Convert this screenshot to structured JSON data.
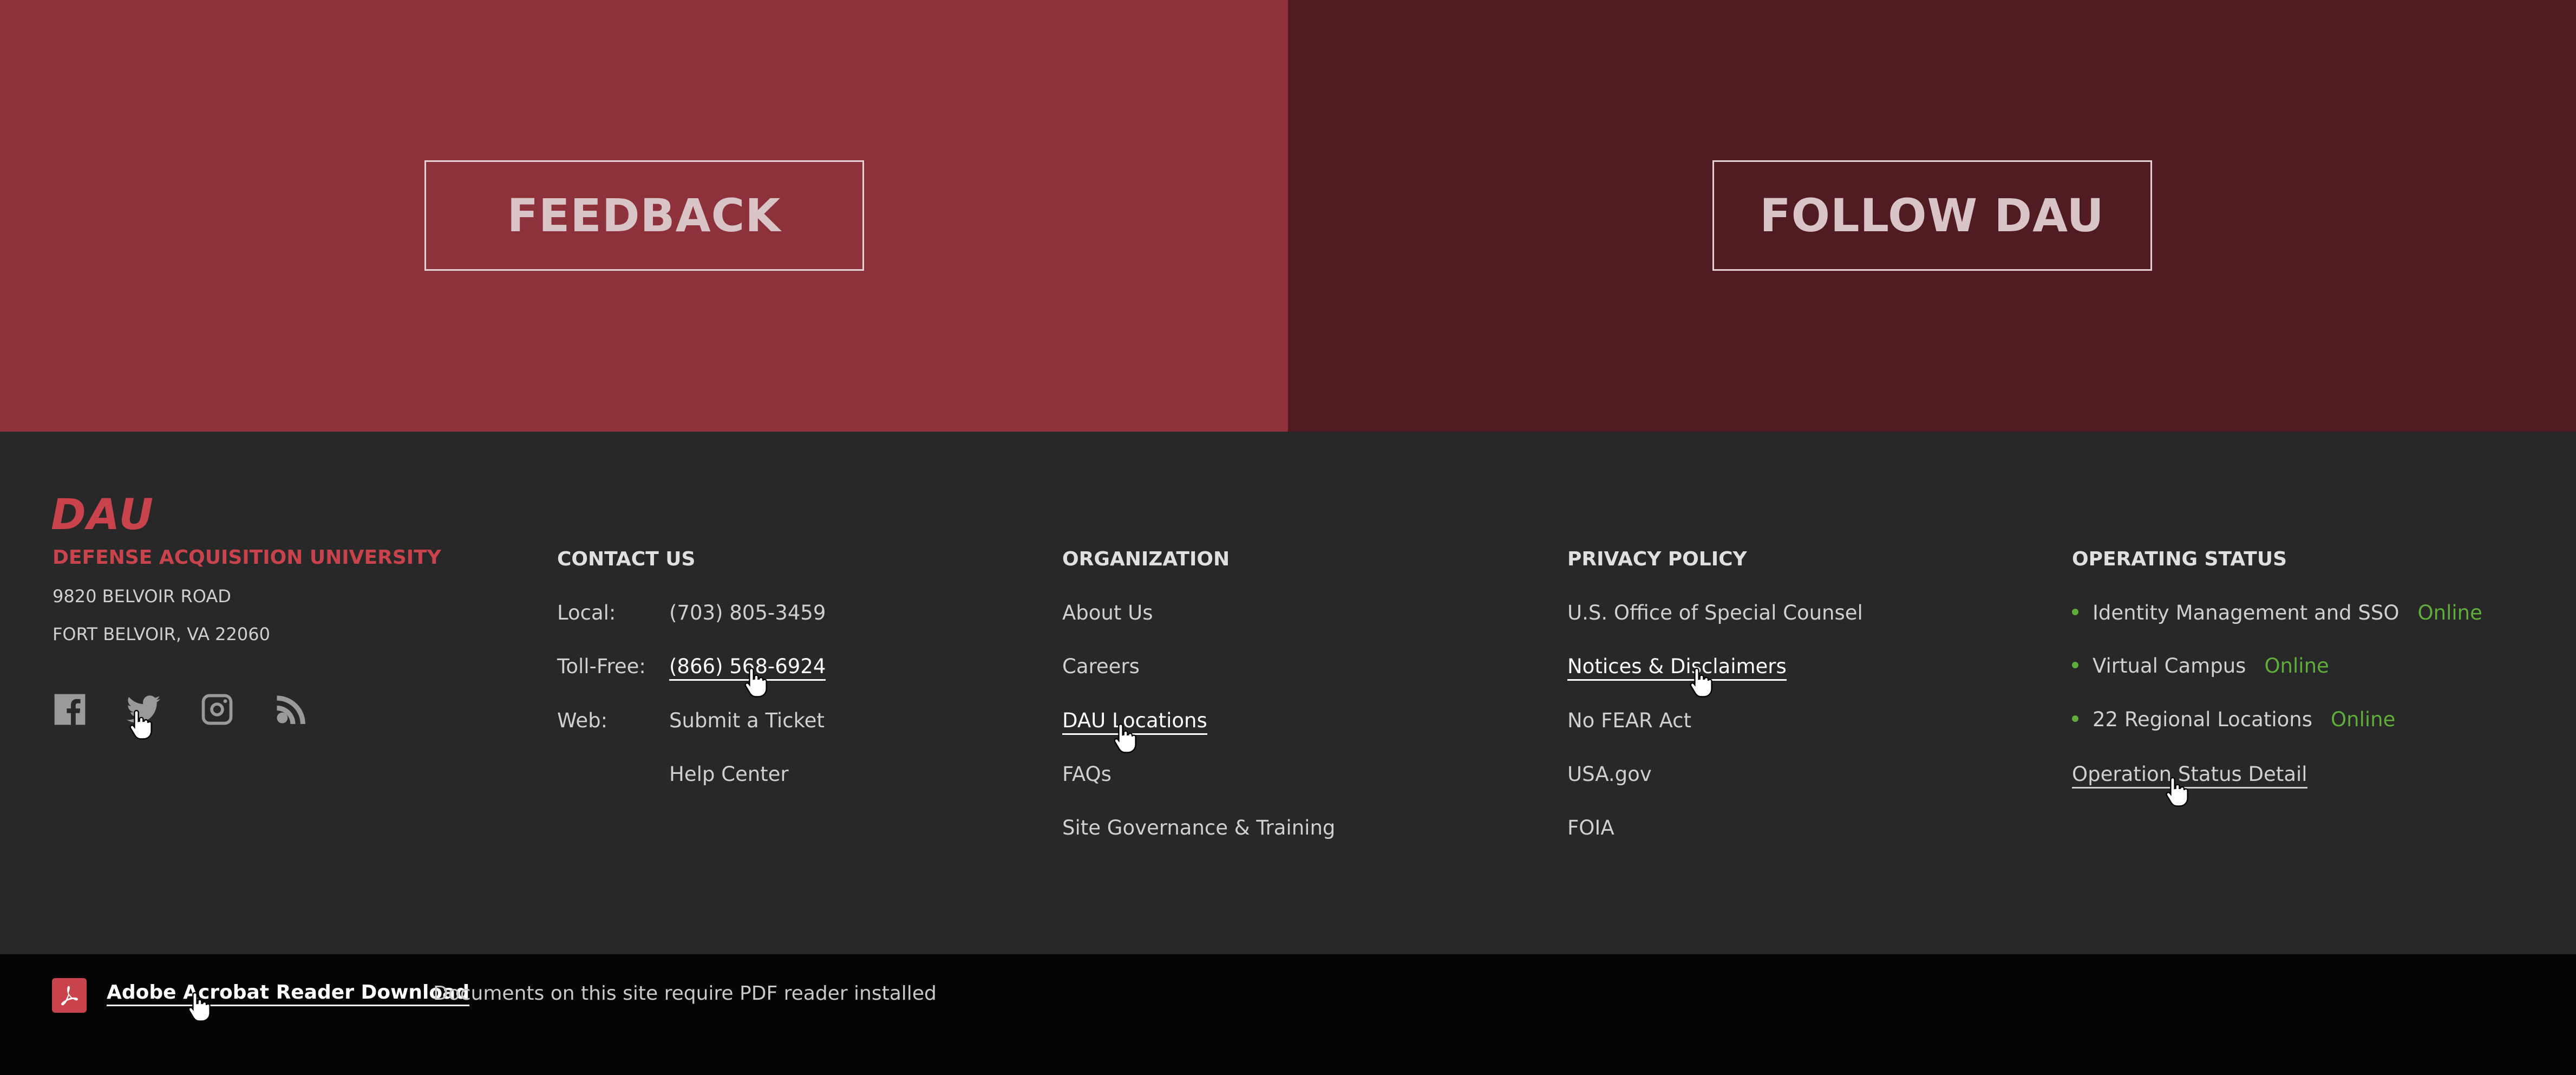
{
  "cta": {
    "feedback_label": "FEEDBACK",
    "follow_label": "FOLLOW DAU"
  },
  "brand": {
    "logo_text": "DAU",
    "name": "DEFENSE ACQUISITION UNIVERSITY",
    "address_line1": "9820 BELVOIR ROAD",
    "address_line2": "FORT BELVOIR, VA 22060"
  },
  "social": [
    "facebook-icon",
    "twitter-icon",
    "instagram-icon",
    "rss-icon"
  ],
  "contact": {
    "heading": "CONTACT US",
    "local_label": "Local:",
    "local_value": "(703) 805-3459",
    "tollfree_label": "Toll-Free:",
    "tollfree_value": "(866) 568-6924",
    "web_label": "Web:",
    "web_value1": "Submit a Ticket",
    "web_value2": "Help Center"
  },
  "organization": {
    "heading": "ORGANIZATION",
    "items": [
      "About Us",
      "Careers",
      "DAU Locations",
      "FAQs",
      "Site Governance & Training"
    ]
  },
  "privacy": {
    "heading": "PRIVACY POLICY",
    "items": [
      "U.S. Office of Special Counsel",
      "Notices & Disclaimers",
      "No FEAR Act",
      "USA.gov",
      "FOIA"
    ]
  },
  "status": {
    "heading": "OPERATING STATUS",
    "items": [
      {
        "label": "Identity Management and SSO",
        "state": "Online"
      },
      {
        "label": "Virtual Campus",
        "state": "Online"
      },
      {
        "label": "22 Regional Locations",
        "state": "Online"
      }
    ],
    "detail_link": "Operation Status Detail"
  },
  "bottom": {
    "download_label": "Adobe Acrobat Reader Download",
    "note": "Documents on this site require PDF reader installed"
  },
  "colors": {
    "cta_left_bg": "#8d323a",
    "cta_right_bg": "#511b22",
    "footer_bg": "#282828",
    "brand_red": "#c9434d",
    "status_green": "#5fae3b"
  }
}
